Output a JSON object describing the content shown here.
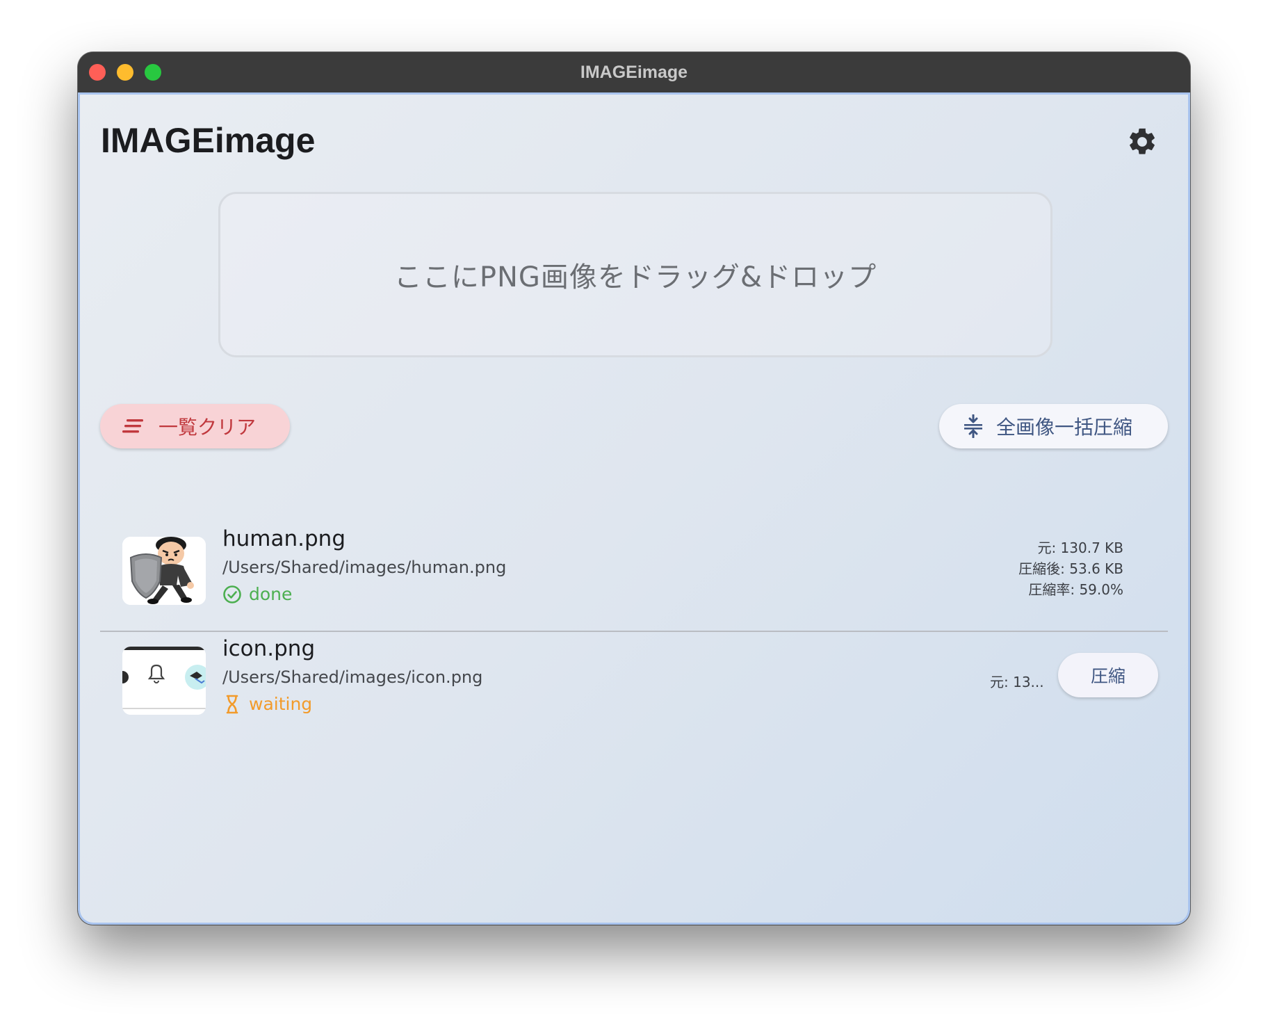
{
  "window": {
    "title": "IMAGEimage"
  },
  "header": {
    "app_title": "IMAGEimage",
    "settings_icon": "gear-icon"
  },
  "dropzone": {
    "text": "ここにPNG画像をドラッグ&ドロップ"
  },
  "toolbar": {
    "clear_label": "一覧クリア",
    "clear_icon": "clear-all-icon",
    "batch_label": "全画像一括圧縮",
    "batch_icon": "compress-icon"
  },
  "files": [
    {
      "name": "human.png",
      "path": "/Users/Shared/images/human.png",
      "status": "done",
      "status_icon": "check-circle-icon",
      "original": "元: 130.7 KB",
      "compressed": "圧縮後: 53.6 KB",
      "ratio": "圧縮率: 59.0%"
    },
    {
      "name": "icon.png",
      "path": "/Users/Shared/images/icon.png",
      "status": "waiting",
      "status_icon": "hourglass-icon",
      "original_truncated": "元: 13...",
      "compress_label": "圧縮"
    }
  ],
  "colors": {
    "accent_red": "#c0383d",
    "accent_blue": "#3f5682",
    "status_done": "#4caf50",
    "status_waiting": "#f29b2b"
  }
}
